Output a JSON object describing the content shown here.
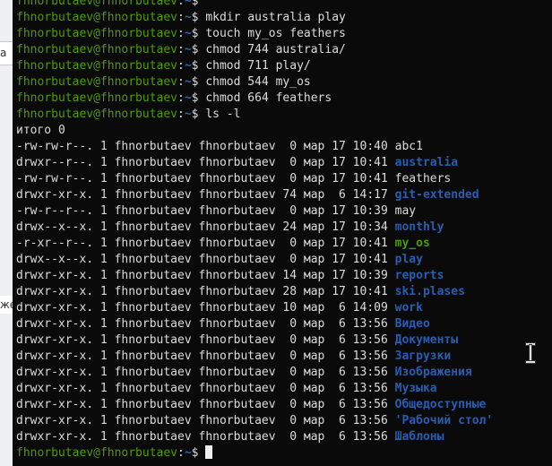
{
  "background_window": {
    "fragment_top": "а",
    "fragment_bottom": "же"
  },
  "terminal": {
    "top_cut_line": {
      "user": "fhnorbutaev@fhnorbutaev",
      "sep": ":",
      "path": "~",
      "sym": "$ "
    },
    "commands": [
      {
        "user": "fhnorbutaev@fhnorbutaev",
        "sep": ":",
        "path": "~",
        "sym": "$ ",
        "cmd": "mkdir australia play"
      },
      {
        "user": "fhnorbutaev@fhnorbutaev",
        "sep": ":",
        "path": "~",
        "sym": "$ ",
        "cmd": "touch my_os feathers"
      },
      {
        "user": "fhnorbutaev@fhnorbutaev",
        "sep": ":",
        "path": "~",
        "sym": "$ ",
        "cmd": "chmod 744 australia/"
      },
      {
        "user": "fhnorbutaev@fhnorbutaev",
        "sep": ":",
        "path": "~",
        "sym": "$ ",
        "cmd": "chmod 711 play/"
      },
      {
        "user": "fhnorbutaev@fhnorbutaev",
        "sep": ":",
        "path": "~",
        "sym": "$ ",
        "cmd": "chmod 544 my_os"
      },
      {
        "user": "fhnorbutaev@fhnorbutaev",
        "sep": ":",
        "path": "~",
        "sym": "$ ",
        "cmd": "chmod 664 feathers"
      },
      {
        "user": "fhnorbutaev@fhnorbutaev",
        "sep": ":",
        "path": "~",
        "sym": "$ ",
        "cmd": "ls -l"
      }
    ],
    "total": "итого 0",
    "listing": [
      {
        "meta": "-rw-rw-r--. 1 fhnorbutaev fhnorbutaev  0 мар 17 10:40 ",
        "name": "abc1",
        "kind": "file"
      },
      {
        "meta": "drwxr--r--. 1 fhnorbutaev fhnorbutaev  0 мар 17 10:41 ",
        "name": "australia",
        "kind": "dir"
      },
      {
        "meta": "-rw-rw-r--. 1 fhnorbutaev fhnorbutaev  0 мар 17 10:41 ",
        "name": "feathers",
        "kind": "file"
      },
      {
        "meta": "drwxr-xr-x. 1 fhnorbutaev fhnorbutaev 74 мар  6 14:17 ",
        "name": "git-extended",
        "kind": "dir"
      },
      {
        "meta": "-rw-r--r--. 1 fhnorbutaev fhnorbutaev  0 мар 17 10:39 ",
        "name": "may",
        "kind": "file"
      },
      {
        "meta": "drwx--x--x. 1 fhnorbutaev fhnorbutaev 24 мар 17 10:34 ",
        "name": "monthly",
        "kind": "dir"
      },
      {
        "meta": "-r-xr--r--. 1 fhnorbutaev fhnorbutaev  0 мар 17 10:41 ",
        "name": "my_os",
        "kind": "exec"
      },
      {
        "meta": "drwx--x--x. 1 fhnorbutaev fhnorbutaev  0 мар 17 10:41 ",
        "name": "play",
        "kind": "dir"
      },
      {
        "meta": "drwxr-xr-x. 1 fhnorbutaev fhnorbutaev 14 мар 17 10:39 ",
        "name": "reports",
        "kind": "dir"
      },
      {
        "meta": "drwxr-xr-x. 1 fhnorbutaev fhnorbutaev 28 мар 17 10:41 ",
        "name": "ski.plases",
        "kind": "dir"
      },
      {
        "meta": "drwxr-xr-x. 1 fhnorbutaev fhnorbutaev 10 мар  6 14:09 ",
        "name": "work",
        "kind": "dir"
      },
      {
        "meta": "drwxr-xr-x. 1 fhnorbutaev fhnorbutaev  0 мар  6 13:56 ",
        "name": "Видео",
        "kind": "dir"
      },
      {
        "meta": "drwxr-xr-x. 1 fhnorbutaev fhnorbutaev  0 мар  6 13:56 ",
        "name": "Документы",
        "kind": "dir"
      },
      {
        "meta": "drwxr-xr-x. 1 fhnorbutaev fhnorbutaev  0 мар  6 13:56 ",
        "name": "Загрузки",
        "kind": "dir"
      },
      {
        "meta": "drwxr-xr-x. 1 fhnorbutaev fhnorbutaev  0 мар  6 13:56 ",
        "name": "Изображения",
        "kind": "dir"
      },
      {
        "meta": "drwxr-xr-x. 1 fhnorbutaev fhnorbutaev  0 мар  6 13:56 ",
        "name": "Музыка",
        "kind": "dir"
      },
      {
        "meta": "drwxr-xr-x. 1 fhnorbutaev fhnorbutaev  0 мар  6 13:56 ",
        "name": "Общедоступные",
        "kind": "dir"
      },
      {
        "meta": "drwxr-xr-x. 1 fhnorbutaev fhnorbutaev  0 мар  6 13:56 ",
        "name": "'Рабочий стол'",
        "kind": "dir"
      },
      {
        "meta": "drwxr-xr-x. 1 fhnorbutaev fhnorbutaev  0 мар  6 13:56 ",
        "name": "Шаблоны",
        "kind": "dir"
      }
    ],
    "final_prompt": {
      "user": "fhnorbutaev@fhnorbutaev",
      "sep": ":",
      "path": "~",
      "sym": "$ "
    },
    "colors": {
      "user": "#4e9a06",
      "path": "#3465a4",
      "dir": "#2a5db0",
      "exec": "#4e9a06",
      "text": "#dcdcdc",
      "background": "#0a0a0a"
    },
    "icons": [
      "text-cursor-icon",
      "mouse-ibeam-icon"
    ]
  }
}
